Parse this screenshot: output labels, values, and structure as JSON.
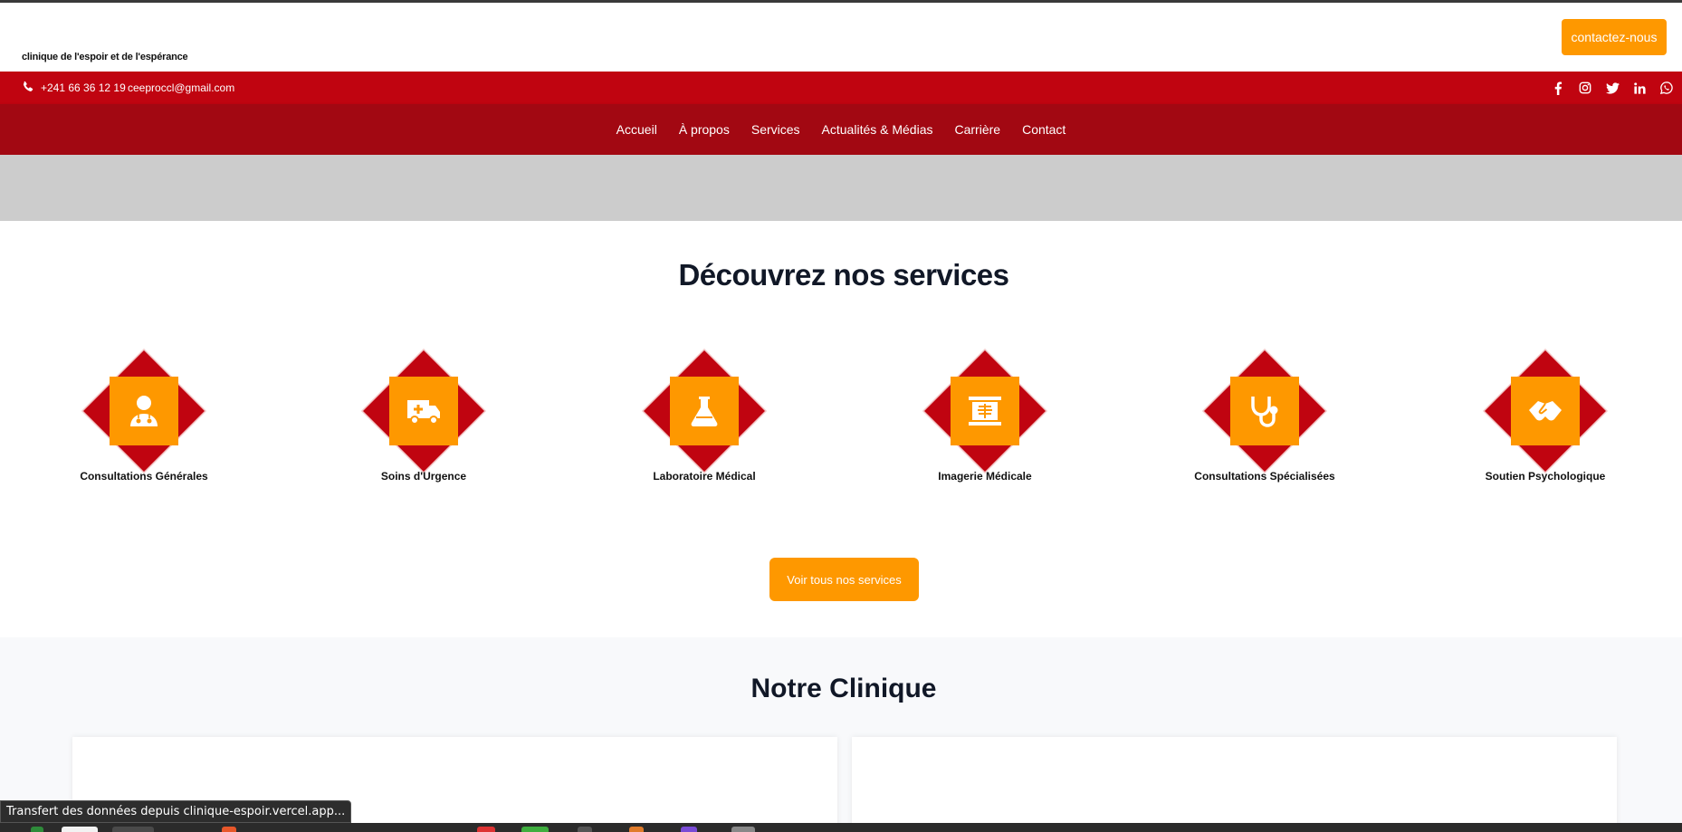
{
  "header": {
    "brand": "clinique de l'espoir et de l'espérance",
    "contact_button": "contactez-nous"
  },
  "infobar": {
    "phone": "+241 66 36 12 19",
    "email": "ceeproccl@gmail.com",
    "socials": [
      "facebook-icon",
      "instagram-icon",
      "twitter-icon",
      "linkedin-icon",
      "whatsapp-icon"
    ]
  },
  "nav": {
    "items": [
      "Accueil",
      "À propos",
      "Services",
      "Actualités & Médias",
      "Carrière",
      "Contact"
    ]
  },
  "services": {
    "title": "Découvrez nos services",
    "items": [
      {
        "label": "Consultations Générales",
        "icon": "doctor-icon"
      },
      {
        "label": "Soins d'Urgence",
        "icon": "ambulance-icon"
      },
      {
        "label": "Laboratoire Médical",
        "icon": "flask-icon"
      },
      {
        "label": "Imagerie Médicale",
        "icon": "x-ray-icon"
      },
      {
        "label": "Consultations Spécialisées",
        "icon": "stethoscope-icon"
      },
      {
        "label": "Soutien Psychologique",
        "icon": "handshake-icon"
      }
    ],
    "button": "Voir tous nos services"
  },
  "clinic": {
    "title": "Notre Clinique"
  },
  "browser": {
    "status": "Transfert des données depuis clinique-espoir.vercel.app..."
  },
  "colors": {
    "accent_orange": "#fe9800",
    "red_bar": "#c00410",
    "nav_red": "#a20812",
    "diamond_red": "#c00410"
  }
}
